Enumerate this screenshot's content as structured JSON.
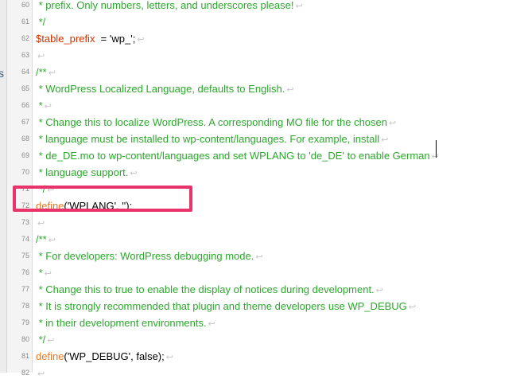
{
  "editor": {
    "left_fragment": "s",
    "eol_glyph": "↩",
    "lines": [
      {
        "num": "60",
        "segments": [
          {
            "t": " * prefix. Only numbers, letters, and underscores please!",
            "c": "comment"
          }
        ],
        "eol": true
      },
      {
        "num": "61",
        "segments": [
          {
            "t": " */",
            "c": "comment"
          }
        ],
        "eol": false
      },
      {
        "num": "62",
        "segments": [
          {
            "t": "$table_prefix",
            "c": "var"
          },
          {
            "t": "  = 'wp_';",
            "c": "plain"
          }
        ],
        "eol": true
      },
      {
        "num": "63",
        "segments": [],
        "eol": true
      },
      {
        "num": "64",
        "segments": [
          {
            "t": "/**",
            "c": "comment"
          }
        ],
        "eol": true
      },
      {
        "num": "65",
        "segments": [
          {
            "t": " * WordPress Localized Language, defaults to English.",
            "c": "comment"
          }
        ],
        "eol": true
      },
      {
        "num": "66",
        "segments": [
          {
            "t": " *",
            "c": "comment"
          }
        ],
        "eol": true
      },
      {
        "num": "67",
        "segments": [
          {
            "t": " * Change this to localize WordPress. A corresponding MO file for the chosen",
            "c": "comment"
          }
        ],
        "eol": true
      },
      {
        "num": "68",
        "segments": [
          {
            "t": " * language must be installed to wp-content/languages. For example, install",
            "c": "comment"
          }
        ],
        "eol": true
      },
      {
        "num": "69",
        "segments": [
          {
            "t": " * de_DE.mo to wp-content/languages and set WPLANG to 'de_DE' to enable German",
            "c": "comment"
          }
        ],
        "eol": true
      },
      {
        "num": "70",
        "segments": [
          {
            "t": " * language support.",
            "c": "comment"
          }
        ],
        "eol": true
      },
      {
        "num": "71",
        "segments": [
          {
            "t": " */",
            "c": "comment"
          }
        ],
        "eol": true
      },
      {
        "num": "72",
        "segments": [
          {
            "t": "define",
            "c": "fn"
          },
          {
            "t": "('WPLANG', '');",
            "c": "plain"
          }
        ],
        "eol": false
      },
      {
        "num": "73",
        "segments": [],
        "eol": true
      },
      {
        "num": "74",
        "segments": [
          {
            "t": "/**",
            "c": "comment"
          }
        ],
        "eol": true
      },
      {
        "num": "75",
        "segments": [
          {
            "t": " * For developers: WordPress debugging mode.",
            "c": "comment"
          }
        ],
        "eol": true
      },
      {
        "num": "76",
        "segments": [
          {
            "t": " *",
            "c": "comment"
          }
        ],
        "eol": true
      },
      {
        "num": "77",
        "segments": [
          {
            "t": " * Change this to true to enable the display of notices during development.",
            "c": "comment"
          }
        ],
        "eol": true
      },
      {
        "num": "78",
        "segments": [
          {
            "t": " * It is strongly recommended that plugin and theme developers use WP_DEBUG",
            "c": "comment"
          }
        ],
        "eol": true
      },
      {
        "num": "79",
        "segments": [
          {
            "t": " * in their development environments.",
            "c": "comment"
          }
        ],
        "eol": true
      },
      {
        "num": "80",
        "segments": [
          {
            "t": " */",
            "c": "comment"
          }
        ],
        "eol": true
      },
      {
        "num": "81",
        "segments": [
          {
            "t": "define",
            "c": "fn"
          },
          {
            "t": "('WP_DEBUG', false);",
            "c": "plain"
          }
        ],
        "eol": true
      },
      {
        "num": "82",
        "segments": [],
        "eol": true
      }
    ],
    "highlighted_line": "72"
  },
  "colors": {
    "comment": "#2ea62e",
    "variable": "#cc3300",
    "function": "#e07b27",
    "highlight": "#e8336b"
  }
}
